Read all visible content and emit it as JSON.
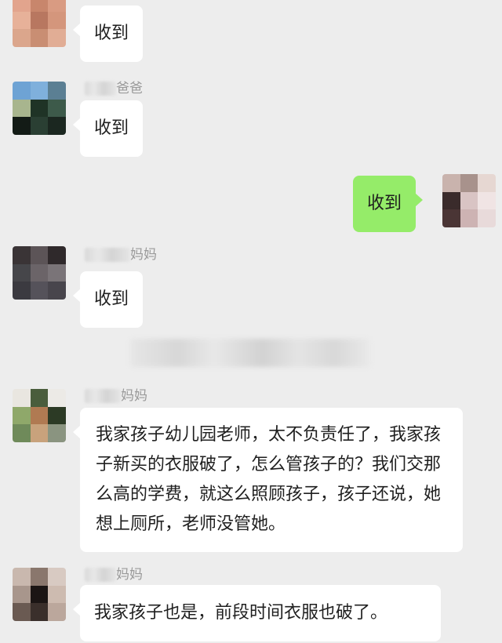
{
  "messages": [
    {
      "sender": "",
      "text": "收到"
    },
    {
      "sender": "爸爸",
      "text": "收到"
    },
    {
      "sender": "",
      "text": "收到",
      "self": true
    },
    {
      "sender": "妈妈",
      "text": "收到"
    },
    {
      "sender": "妈妈",
      "text": "我家孩子幼儿园老师，太不负责任了，我家孩子新买的衣服破了，怎么管孩子的？我们交那么高的学费，就这么照顾孩子，孩子还说，她想上厕所，老师没管她。"
    },
    {
      "sender": "妈妈",
      "text": "我家孩子也是，前段时间衣服也破了。"
    }
  ],
  "colors": {
    "background": "#ededed",
    "bubble_other": "#ffffff",
    "bubble_self": "#95ec69",
    "name_text": "#9a9a9a"
  }
}
